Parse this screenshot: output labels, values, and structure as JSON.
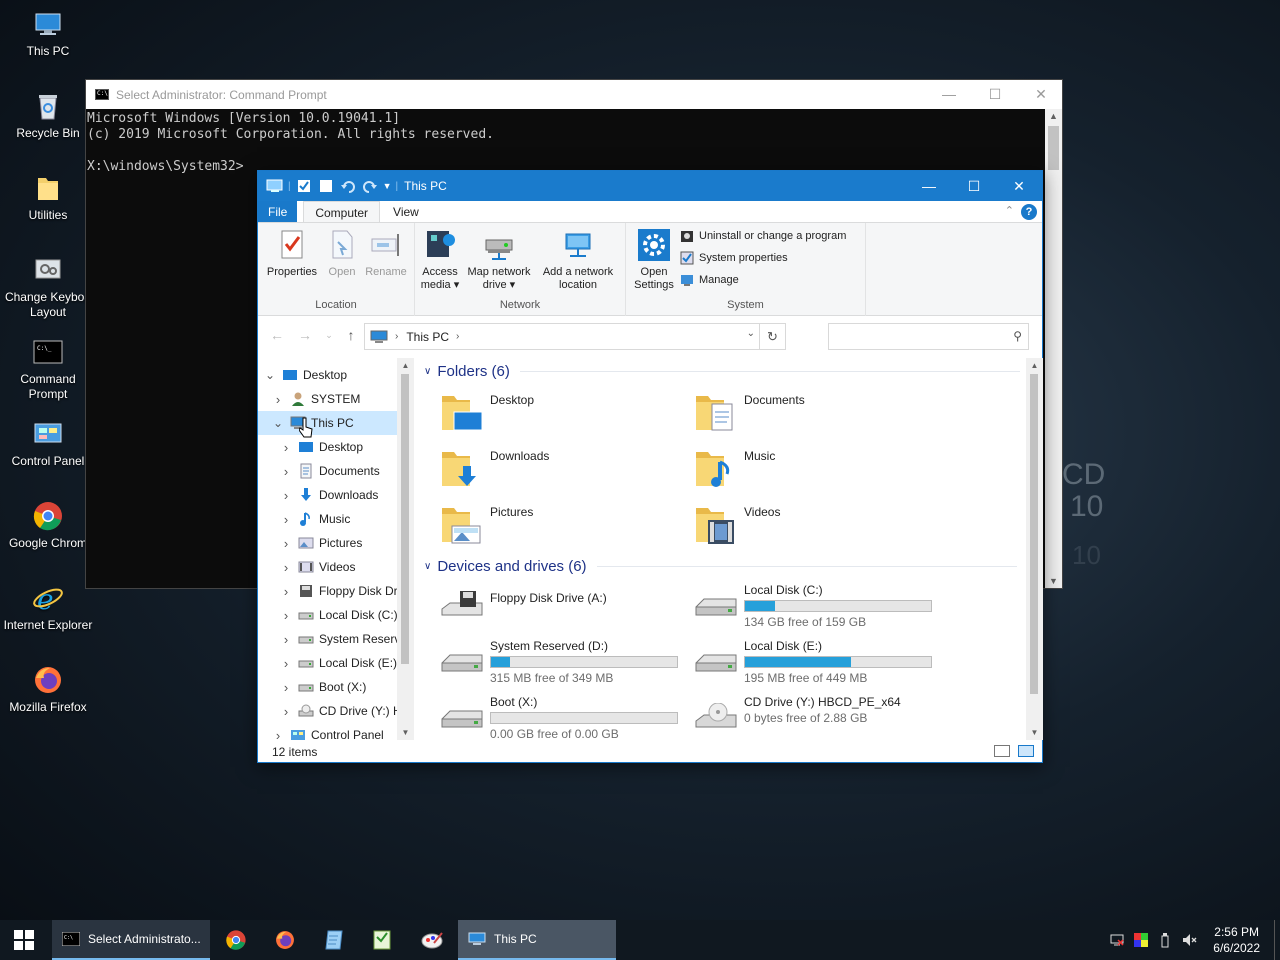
{
  "desktop": {
    "icons": [
      {
        "label": "This PC",
        "icon": "computer-icon"
      },
      {
        "label": "Recycle Bin",
        "icon": "recycle-bin-icon"
      },
      {
        "label": "Utilities",
        "icon": "folder-icon"
      },
      {
        "label": "Change Keyboa\nLayout",
        "icon": "keyboard-settings-icon"
      },
      {
        "label": "Command\nPrompt",
        "icon": "command-prompt-icon"
      },
      {
        "label": "Control Panel",
        "icon": "control-panel-icon"
      },
      {
        "label": "Google Chrom",
        "icon": "chrome-icon"
      },
      {
        "label": "Internet Explorer",
        "icon": "internet-explorer-icon"
      },
      {
        "label": "Mozilla Firefox",
        "icon": "firefox-icon"
      }
    ],
    "wallpaper_text": [
      "CD",
      "10",
      "10"
    ]
  },
  "cmd": {
    "title": "Select Administrator: Command Prompt",
    "lines": [
      "Microsoft Windows [Version 10.0.19041.1]",
      "(c) 2019 Microsoft Corporation. All rights reserved.",
      "",
      "X:\\windows\\System32>"
    ]
  },
  "explorer": {
    "title": "This PC",
    "tabs": {
      "file": "File",
      "computer": "Computer",
      "view": "View"
    },
    "ribbon": {
      "location": {
        "label": "Location",
        "properties": "Properties",
        "open": "Open",
        "rename": "Rename"
      },
      "network": {
        "label": "Network",
        "access_media": "Access\nmedia ▾",
        "map_drive": "Map network\ndrive ▾",
        "add_location": "Add a network\nlocation"
      },
      "system": {
        "label": "System",
        "open_settings": "Open\nSettings",
        "uninstall": "Uninstall or change a program",
        "system_properties": "System properties",
        "manage": "Manage"
      }
    },
    "address": {
      "crumb": "This PC"
    },
    "search": {
      "placeholder": ""
    },
    "nav": [
      {
        "label": "Desktop",
        "level": 0,
        "expanded": true,
        "icon": "desktop-icon"
      },
      {
        "label": "SYSTEM",
        "level": 1,
        "expanded": false,
        "icon": "user-icon"
      },
      {
        "label": "This PC",
        "level": 1,
        "expanded": true,
        "icon": "computer-icon",
        "selected": true
      },
      {
        "label": "Desktop",
        "level": 2,
        "expanded": false,
        "icon": "desktop-icon"
      },
      {
        "label": "Documents",
        "level": 2,
        "expanded": false,
        "icon": "documents-icon"
      },
      {
        "label": "Downloads",
        "level": 2,
        "expanded": false,
        "icon": "downloads-icon"
      },
      {
        "label": "Music",
        "level": 2,
        "expanded": false,
        "icon": "music-icon"
      },
      {
        "label": "Pictures",
        "level": 2,
        "expanded": false,
        "icon": "pictures-icon"
      },
      {
        "label": "Videos",
        "level": 2,
        "expanded": false,
        "icon": "videos-icon"
      },
      {
        "label": "Floppy Disk Dri",
        "level": 2,
        "expanded": false,
        "icon": "floppy-icon"
      },
      {
        "label": "Local Disk (C:)",
        "level": 2,
        "expanded": false,
        "icon": "drive-icon"
      },
      {
        "label": "System Reserve",
        "level": 2,
        "expanded": false,
        "icon": "drive-icon"
      },
      {
        "label": "Local Disk (E:)",
        "level": 2,
        "expanded": false,
        "icon": "drive-icon"
      },
      {
        "label": "Boot (X:)",
        "level": 2,
        "expanded": false,
        "icon": "drive-icon"
      },
      {
        "label": "CD Drive (Y:) H",
        "level": 2,
        "expanded": false,
        "icon": "cd-drive-icon"
      },
      {
        "label": "Control Panel",
        "level": 1,
        "expanded": false,
        "icon": "control-panel-icon"
      }
    ],
    "folders_header": "Folders (6)",
    "folders": [
      {
        "name": "Desktop",
        "icon": "desktop-folder-icon"
      },
      {
        "name": "Documents",
        "icon": "documents-folder-icon"
      },
      {
        "name": "Downloads",
        "icon": "downloads-folder-icon"
      },
      {
        "name": "Music",
        "icon": "music-folder-icon"
      },
      {
        "name": "Pictures",
        "icon": "pictures-folder-icon"
      },
      {
        "name": "Videos",
        "icon": "videos-folder-icon"
      }
    ],
    "drives_header": "Devices and drives (6)",
    "drives": [
      {
        "name": "Floppy Disk Drive (A:)",
        "free": "",
        "used_fraction": null,
        "icon": "floppy-icon"
      },
      {
        "name": "Local Disk (C:)",
        "free": "134 GB free of 159 GB",
        "used_fraction": 0.16,
        "icon": "drive-icon"
      },
      {
        "name": "System Reserved (D:)",
        "free": "315 MB free of 349 MB",
        "used_fraction": 0.1,
        "icon": "drive-icon"
      },
      {
        "name": "Local Disk (E:)",
        "free": "195 MB free of 449 MB",
        "used_fraction": 0.57,
        "icon": "drive-icon"
      },
      {
        "name": "Boot (X:)",
        "free": "0.00 GB free of 0.00 GB",
        "used_fraction": 0.0,
        "icon": "drive-icon"
      },
      {
        "name": "CD Drive (Y:) HBCD_PE_x64",
        "free": "0 bytes free of 2.88 GB",
        "used_fraction": null,
        "icon": "cd-drive-icon"
      }
    ],
    "status": "12 items"
  },
  "taskbar": {
    "cmd_label": "Select Administrato...",
    "explorer_label": "This PC",
    "pinned": [
      "chrome-icon",
      "firefox-icon",
      "notepad-icon",
      "text-editor-icon",
      "paint-icon"
    ],
    "time": "2:56 PM",
    "date": "6/6/2022"
  },
  "colors": {
    "accent": "#1979ca",
    "title_bar": "#1a7bcc",
    "progress": "#26a0da",
    "selection": "#cce8ff"
  }
}
